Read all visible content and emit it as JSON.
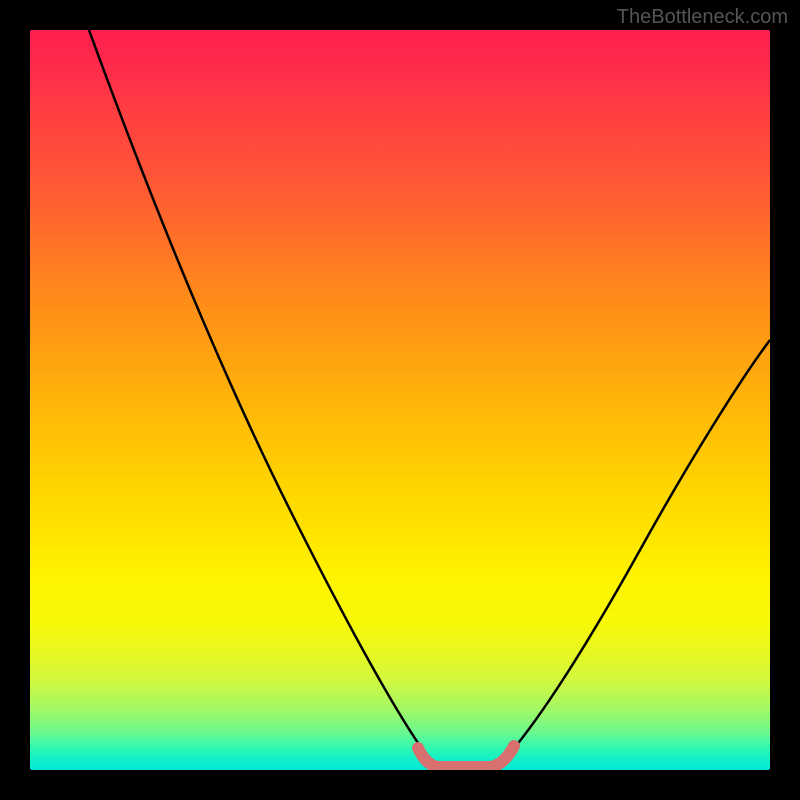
{
  "watermark": "TheBottleneck.com",
  "chart_data": {
    "type": "line",
    "title": "",
    "xlabel": "",
    "ylabel": "",
    "xlim": [
      0,
      100
    ],
    "ylim": [
      0,
      100
    ],
    "grid": false,
    "legend": false,
    "gradient": {
      "orientation": "vertical",
      "stops": [
        {
          "pos": 0,
          "color": "#ff1f4f"
        },
        {
          "pos": 50,
          "color": "#ffd000"
        },
        {
          "pos": 100,
          "color": "#00e8d8"
        }
      ]
    },
    "series": [
      {
        "name": "left-curve",
        "color": "#000000",
        "x": [
          8,
          12,
          18,
          24,
          30,
          36,
          42,
          47,
          51,
          54
        ],
        "y": [
          100,
          88,
          72,
          58,
          44,
          31,
          19,
          9,
          3,
          0
        ]
      },
      {
        "name": "right-curve",
        "color": "#000000",
        "x": [
          64,
          68,
          73,
          79,
          85,
          92,
          100
        ],
        "y": [
          0,
          4,
          10,
          19,
          30,
          43,
          58
        ]
      },
      {
        "name": "valley-marker",
        "color": "#e57373",
        "thick": true,
        "x": [
          52,
          54,
          56,
          58,
          60,
          62,
          64,
          66
        ],
        "y": [
          2.5,
          0.5,
          0,
          0,
          0,
          0,
          0.5,
          2.5
        ]
      }
    ]
  }
}
